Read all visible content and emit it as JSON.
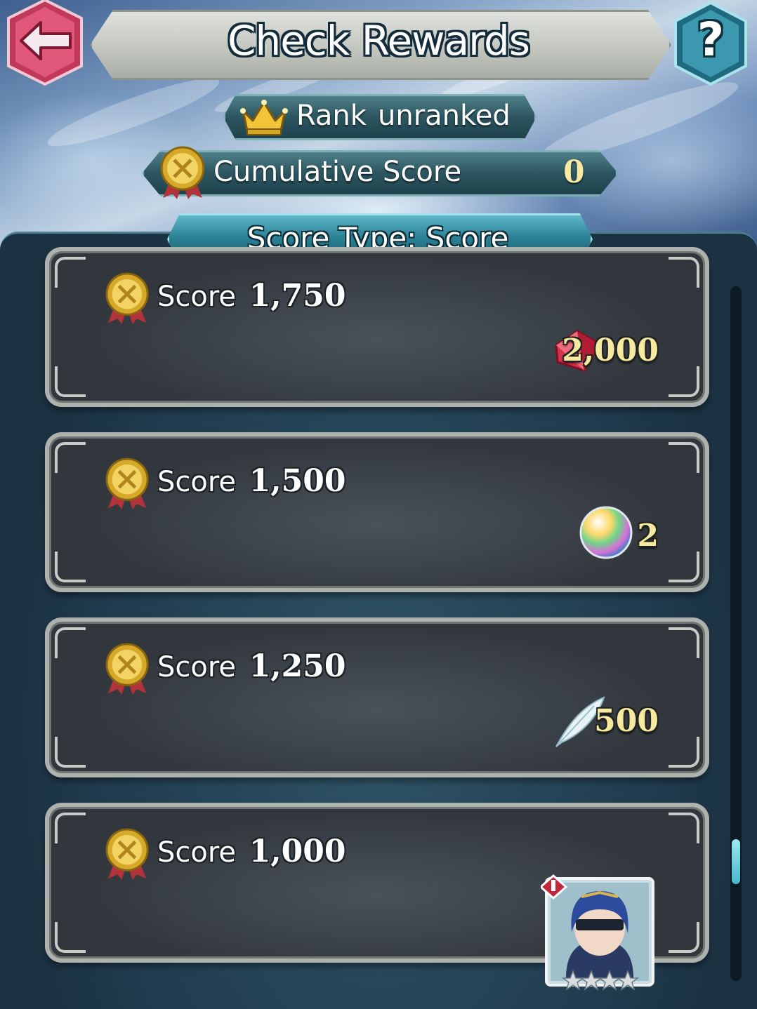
{
  "header": {
    "title": "Check Rewards",
    "back_icon": "back-arrow-icon",
    "help_label": "?"
  },
  "status": {
    "rank_label": "Rank",
    "rank_value": "unranked",
    "cumulative_label": "Cumulative Score",
    "cumulative_value": "0",
    "score_type": "Score Type: Score"
  },
  "rewards": [
    {
      "score_label": "Score",
      "score_value": "1,750",
      "reward_icon": "orb-icon",
      "reward_value": "2,000"
    },
    {
      "score_label": "Score",
      "score_value": "1,500",
      "reward_icon": "rainbow-orb-icon",
      "reward_value": "2"
    },
    {
      "score_label": "Score",
      "score_value": "1,250",
      "reward_icon": "feather-icon",
      "reward_value": "500"
    },
    {
      "score_label": "Score",
      "score_value": "1,000",
      "reward_icon": "hero-portrait",
      "reward_value": ""
    }
  ],
  "colors": {
    "accent_teal": "#2c8295",
    "reward_gold": "#f7eaa0",
    "back_red": "#d83a5f",
    "help_teal": "#2e8aa0"
  },
  "scroll": {
    "position_fraction": 0.85
  }
}
